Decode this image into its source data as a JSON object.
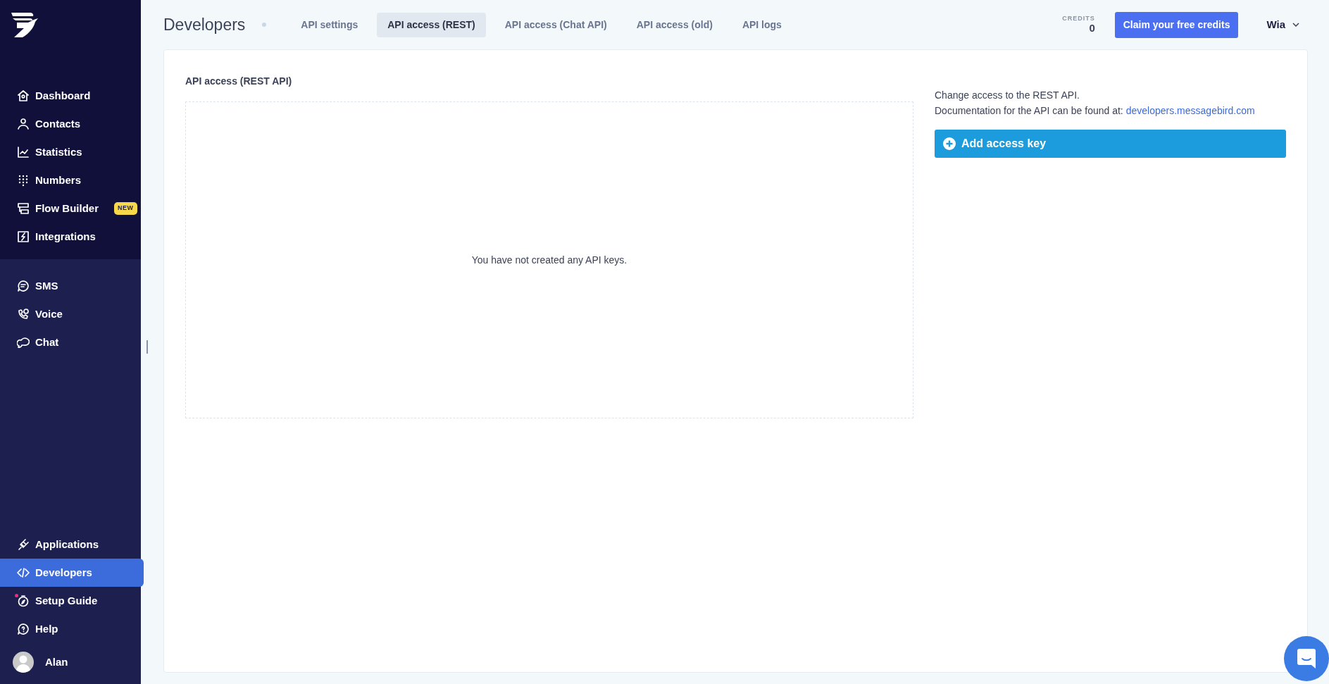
{
  "sidebar": {
    "groups": [
      {
        "items": [
          {
            "label": "Dashboard",
            "selected": false,
            "notification": false
          },
          {
            "label": "Contacts",
            "selected": false,
            "notification": false
          },
          {
            "label": "Statistics",
            "selected": false,
            "notification": false
          },
          {
            "label": "Numbers",
            "selected": false,
            "notification": false
          },
          {
            "label": "Flow Builder",
            "selected": false,
            "notification": false,
            "badge": "NEW"
          },
          {
            "label": "Integrations",
            "selected": false,
            "notification": false
          }
        ]
      },
      {
        "items": [
          {
            "label": "SMS",
            "selected": false,
            "notification": false
          },
          {
            "label": "Voice",
            "selected": false,
            "notification": false
          },
          {
            "label": "Chat",
            "selected": false,
            "notification": false
          }
        ]
      },
      {
        "items": [
          {
            "label": "Applications",
            "selected": false,
            "notification": false
          },
          {
            "label": "Developers",
            "selected": true,
            "notification": false
          },
          {
            "label": "Setup Guide",
            "selected": false,
            "notification": true
          },
          {
            "label": "Help",
            "selected": false,
            "notification": false
          }
        ]
      }
    ],
    "user": {
      "name": "Alan"
    }
  },
  "header": {
    "title": "Developers",
    "tabs": [
      {
        "label": "API settings",
        "selected": false
      },
      {
        "label": "API access (REST)",
        "selected": true
      },
      {
        "label": "API access (Chat API)",
        "selected": false
      },
      {
        "label": "API access (old)",
        "selected": false
      },
      {
        "label": "API logs",
        "selected": false
      }
    ],
    "credits": {
      "label": "CREDITS",
      "value": "0"
    },
    "claim_button": "Claim your free credits",
    "account": "Wia"
  },
  "content": {
    "heading": "API access (REST API)",
    "empty_message": "You have not created any API keys.",
    "description": "Change access to the REST API.",
    "doc_text": "Documentation for the API can be found at:",
    "doc_link": "developers.messagebird.com",
    "add_button": "Add access key"
  }
}
